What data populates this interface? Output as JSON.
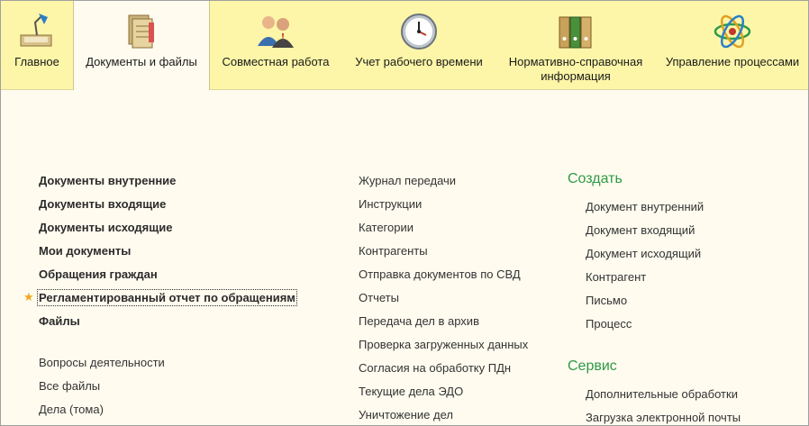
{
  "sections": [
    {
      "label": "Главное",
      "icon": "lamp-icon"
    },
    {
      "label": "Документы и файлы",
      "icon": "documents-icon"
    },
    {
      "label": "Совместная работа",
      "icon": "people-icon"
    },
    {
      "label": "Учет рабочего времени",
      "icon": "clock-icon"
    },
    {
      "label": "Нормативно-справочная\nинформация",
      "icon": "binders-icon"
    },
    {
      "label": "Управление процессами",
      "icon": "process-icon"
    }
  ],
  "col1_bold": [
    "Документы внутренние",
    "Документы входящие",
    "Документы исходящие",
    "Мои документы",
    "Обращения граждан",
    "Регламентированный отчет по обращениям",
    "Файлы"
  ],
  "col1_regular": [
    "Вопросы деятельности",
    "Все файлы",
    "Дела (тома)"
  ],
  "col2": [
    "Журнал передачи",
    "Инструкции",
    "Категории",
    "Контрагенты",
    "Отправка документов по СВД",
    "Отчеты",
    "Передача дел в архив",
    "Проверка загруженных данных",
    "Согласия на обработку ПДн",
    "Текущие дела ЭДО",
    "Уничтожение дел"
  ],
  "create": {
    "title": "Создать",
    "items": [
      "Документ внутренний",
      "Документ входящий",
      "Документ исходящий",
      "Контрагент",
      "Письмо",
      "Процесс"
    ]
  },
  "service": {
    "title": "Сервис",
    "items": [
      "Дополнительные обработки",
      "Загрузка электронной почты"
    ]
  },
  "colors": {
    "toolbar": "#fdf6a8",
    "content": "#fffbef",
    "group_title": "#2e9a46",
    "star": "#f2a81d"
  }
}
